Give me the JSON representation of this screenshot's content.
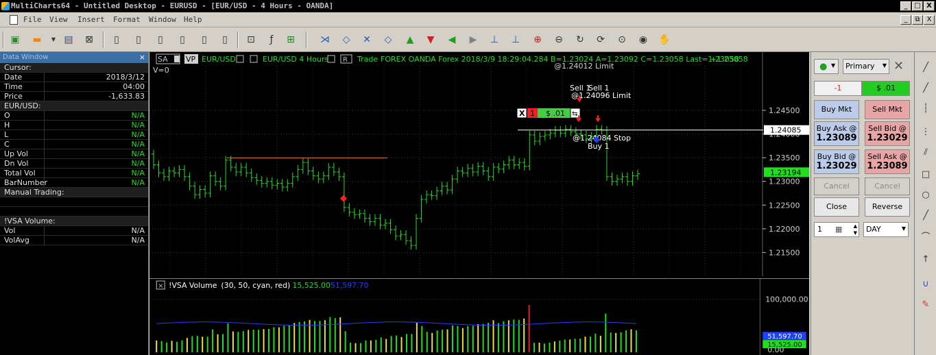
{
  "window": {
    "title": "MultiCharts64 - Untitled Desktop - EURUSD - [EUR/USD - 4 Hours - OANDA]",
    "min": "_",
    "max": "□",
    "close": "X",
    "mdi_restore": "⧉"
  },
  "menu": [
    "File",
    "View",
    "Insert",
    "Format",
    "Window",
    "Help"
  ],
  "data_window": {
    "title": "Data Window",
    "sections": [
      {
        "header": "Cursor:",
        "rows": [
          {
            "label": "Date",
            "value": "2018/3/12"
          },
          {
            "label": "Time",
            "value": "04:00"
          },
          {
            "label": "Price",
            "value": "-1,633.83"
          }
        ]
      },
      {
        "header": "EUR/USD:",
        "rows": [
          {
            "label": "O",
            "value": "N/A"
          },
          {
            "label": "H",
            "value": "N/A"
          },
          {
            "label": "L",
            "value": "N/A"
          },
          {
            "label": "C",
            "value": "N/A"
          },
          {
            "label": "Up Vol",
            "value": "N/A"
          },
          {
            "label": "Dn Vol",
            "value": "N/A"
          },
          {
            "label": "Total Vol",
            "value": "N/A"
          },
          {
            "label": "BarNumber",
            "value": "N/A"
          }
        ]
      },
      {
        "header": "Manual Trading:",
        "rows": []
      },
      {
        "header": "!VSA Volume:",
        "rows": [
          {
            "label": "Vol",
            "value": "N/A"
          },
          {
            "label": "VolAvg",
            "value": "N/A"
          }
        ]
      }
    ]
  },
  "chart": {
    "header": {
      "sa": "SA",
      "vp": "VP",
      "symbol": "EUR/USD",
      "interval": "EUR/USD  4 Hours",
      "r": "R",
      "trade": "Trade",
      "info": "FOREX  OANDA  Forex   2018/3/9    18:29:04.284   B=1.23024   A=1.23092   C=1.23058   Last=1.23058",
      "change": "+1.23058"
    },
    "v_label": "V=0",
    "price_axis": {
      "min": 1.21,
      "max": 1.2544,
      "ticks": [
        "1.24500",
        "1.24000",
        "1.23500",
        "1.23000",
        "1.22500",
        "1.22000",
        "1.21500"
      ]
    },
    "last_price_marker": "1.23194",
    "position_line_value": "1.24085",
    "position_line_price": 1.24085,
    "resistance_price": 1.23496,
    "trade_widget": {
      "close": "X",
      "qty": "1",
      "pnl": "$ .01"
    },
    "orders": [
      {
        "text": "@1.24012 Limit",
        "arrow_price": 1.2467
      },
      {
        "text": "Sell 1",
        "arrow_price": 1.2425
      },
      {
        "text": "Sell 1",
        "arrow_price": 1.2425
      },
      {
        "text": "@1.24096 Limit",
        "arrow_price": 1.2425
      },
      {
        "text": "@1.24084 Stop",
        "arrow_price": 1.2395
      },
      {
        "text": "Buy 1",
        "arrow_price": 1.2395
      }
    ],
    "sell_signal_price": 1.2264,
    "candles": [
      [
        1.2358,
        1.2335
      ],
      [
        1.2335,
        1.2318
      ],
      [
        1.2318,
        1.231
      ],
      [
        1.231,
        1.2322
      ],
      [
        1.2322,
        1.2318
      ],
      [
        1.2318,
        1.2325
      ],
      [
        1.2325,
        1.231
      ],
      [
        1.231,
        1.229
      ],
      [
        1.229,
        1.2272
      ],
      [
        1.2272,
        1.2283
      ],
      [
        1.2283,
        1.2275
      ],
      [
        1.2275,
        1.2312
      ],
      [
        1.2312,
        1.23
      ],
      [
        1.23,
        1.229
      ],
      [
        1.229,
        1.2345
      ],
      [
        1.2345,
        1.233
      ],
      [
        1.233,
        1.232
      ],
      [
        1.232,
        1.233
      ],
      [
        1.233,
        1.2318
      ],
      [
        1.2318,
        1.2308
      ],
      [
        1.2308,
        1.2302
      ],
      [
        1.2302,
        1.2296
      ],
      [
        1.2296,
        1.23
      ],
      [
        1.23,
        1.2292
      ],
      [
        1.2292,
        1.2296
      ],
      [
        1.2296,
        1.2288
      ],
      [
        1.2288,
        1.2296
      ],
      [
        1.2296,
        1.231
      ],
      [
        1.231,
        1.2325
      ],
      [
        1.2325,
        1.234
      ],
      [
        1.234,
        1.2322
      ],
      [
        1.2322,
        1.2312
      ],
      [
        1.2312,
        1.2305
      ],
      [
        1.2305,
        1.2312
      ],
      [
        1.2312,
        1.233
      ],
      [
        1.233,
        1.232
      ],
      [
        1.232,
        1.231
      ],
      [
        1.231,
        1.2245
      ],
      [
        1.2245,
        1.2235
      ],
      [
        1.2235,
        1.223
      ],
      [
        1.223,
        1.2232
      ],
      [
        1.2232,
        1.2222
      ],
      [
        1.2222,
        1.2215
      ],
      [
        1.2215,
        1.2222
      ],
      [
        1.2222,
        1.2208
      ],
      [
        1.2208,
        1.2212
      ],
      [
        1.2212,
        1.2198
      ],
      [
        1.2198,
        1.2185
      ],
      [
        1.2185,
        1.2188
      ],
      [
        1.2188,
        1.2175
      ],
      [
        1.2175,
        1.2165
      ],
      [
        1.2165,
        1.2222
      ],
      [
        1.2222,
        1.2262
      ],
      [
        1.2262,
        1.2272
      ],
      [
        1.2272,
        1.227
      ],
      [
        1.227,
        1.228
      ],
      [
        1.228,
        1.229
      ],
      [
        1.229,
        1.2282
      ],
      [
        1.2282,
        1.2305
      ],
      [
        1.2305,
        1.2322
      ],
      [
        1.2322,
        1.2318
      ],
      [
        1.2318,
        1.2328
      ],
      [
        1.2328,
        1.232
      ],
      [
        1.232,
        1.2332
      ],
      [
        1.2332,
        1.2322
      ],
      [
        1.2322,
        1.231
      ],
      [
        1.231,
        1.233
      ],
      [
        1.233,
        1.2326
      ],
      [
        1.2326,
        1.2335
      ],
      [
        1.2335,
        1.2345
      ],
      [
        1.2345,
        1.2335
      ],
      [
        1.2335,
        1.234
      ],
      [
        1.234,
        1.2332
      ],
      [
        1.2332,
        1.2398
      ],
      [
        1.2398,
        1.2385
      ],
      [
        1.2385,
        1.2395
      ],
      [
        1.2395,
        1.2398
      ],
      [
        1.2398,
        1.2402
      ],
      [
        1.2402,
        1.2408
      ],
      [
        1.2408,
        1.2402
      ],
      [
        1.2402,
        1.241
      ],
      [
        1.241,
        1.2405
      ],
      [
        1.2405,
        1.24
      ],
      [
        1.24,
        1.2398
      ],
      [
        1.2398,
        1.239
      ],
      [
        1.239,
        1.2395
      ],
      [
        1.2395,
        1.241
      ],
      [
        1.241,
        1.2408
      ],
      [
        1.2408,
        1.231
      ],
      [
        1.231,
        1.23
      ],
      [
        1.23,
        1.2305
      ],
      [
        1.2305,
        1.231
      ],
      [
        1.231,
        1.23
      ],
      [
        1.23,
        1.2312
      ],
      [
        1.2312,
        1.2316
      ]
    ],
    "volume": {
      "label": "!VSA Volume",
      "params": "(30, 50, cyan, red)",
      "value1": "15,525.00",
      "value2": "51,597.70",
      "axis_ticks": [
        "100,000.00",
        "0.00"
      ],
      "axis_max": 110000,
      "avg_value": 51597.7,
      "marker1": "51,597.70",
      "marker2": "15,525.00"
    },
    "colors": {
      "up": "#22dd22",
      "down": "#22dd22",
      "resistance": "#e08030",
      "sell": "#ff2020",
      "buy": "#2040ff"
    }
  },
  "order_panel": {
    "account": "Primary",
    "qty_neg": "-1",
    "pnl": "$ .01",
    "buy_mkt": "Buy Mkt",
    "sell_mkt": "Sell Mkt",
    "buy_ask_label": "Buy Ask @",
    "buy_ask_value": "1.23089",
    "sell_bid_label": "Sell Bid @",
    "sell_bid_value": "1.23029",
    "buy_bid_label": "Buy Bid @",
    "buy_bid_value": "1.23029",
    "sell_ask_label": "Sell Ask @",
    "sell_ask_value": "1.23089",
    "cancel_bids": "Cancel Bids",
    "cancel_asks": "Cancel Asks",
    "close": "Close",
    "reverse": "Reverse",
    "quantity": "1",
    "duration": "DAY"
  }
}
